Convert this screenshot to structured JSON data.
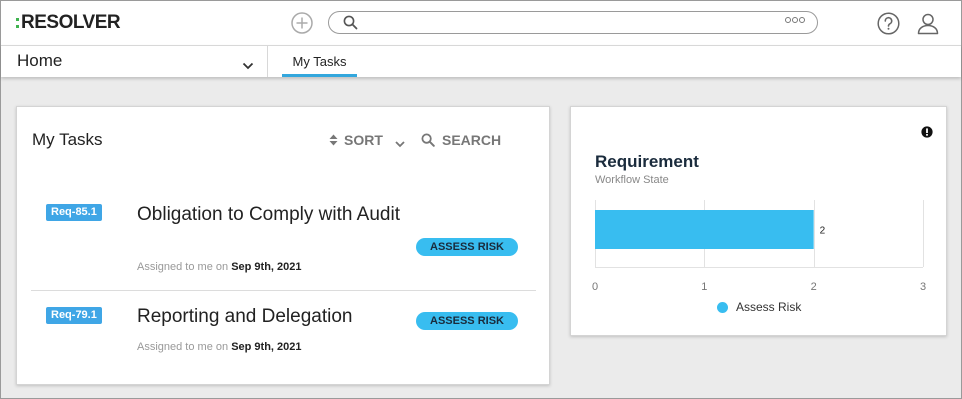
{
  "header": {
    "logo_text": "RESOLVER",
    "brand_color": "#3fb34f",
    "icons": [
      "add-icon",
      "search-icon",
      "more-options-icon",
      "help-icon",
      "user-icon"
    ]
  },
  "nav": {
    "selected_page": "Home",
    "tabs": [
      {
        "label": "My Tasks",
        "active": true
      }
    ],
    "accent_color": "#33a7dd"
  },
  "tasks_panel": {
    "title": "My Tasks",
    "sort_label": "SORT",
    "search_label": "SEARCH",
    "tasks": [
      {
        "id": "Req-85.1",
        "title": "Obligation to Comply with Audit",
        "status": "ASSESS RISK",
        "assigned_prefix": "Assigned to me on",
        "assigned_date": "Sep 9th, 2021"
      },
      {
        "id": "Req-79.1",
        "title": "Reporting and Delegation",
        "status": "ASSESS RISK",
        "assigned_prefix": "Assigned to me on",
        "assigned_date": "Sep 9th, 2021"
      }
    ]
  },
  "chart_panel": {
    "title": "Requirement",
    "subtitle": "Workflow State"
  },
  "chart_data": {
    "type": "bar",
    "orientation": "horizontal",
    "categories": [
      ""
    ],
    "series": [
      {
        "name": "Assess Risk",
        "values": [
          2
        ],
        "color": "#38bdf0"
      }
    ],
    "data_labels": [
      "2"
    ],
    "xlim": [
      0,
      3
    ],
    "x_ticks": [
      "0",
      "1",
      "2",
      "3"
    ],
    "grid": true,
    "legend": "bottom"
  }
}
